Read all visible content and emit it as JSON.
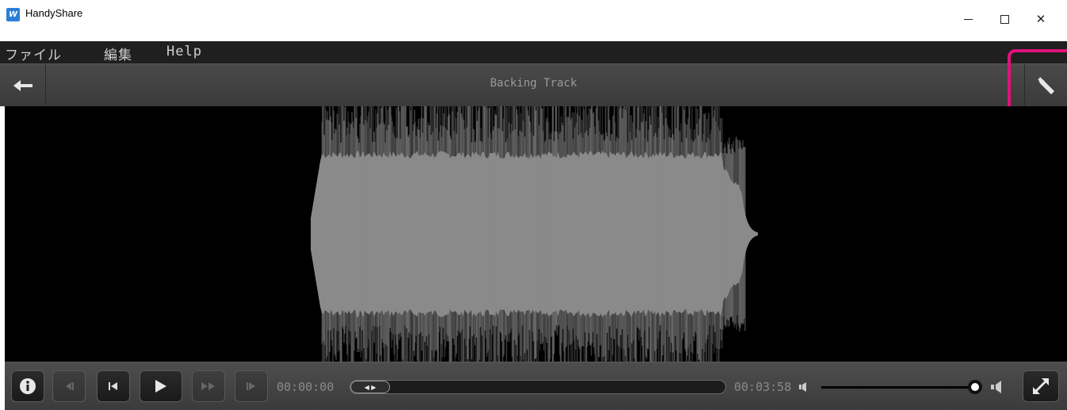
{
  "window": {
    "app_icon": "app-logo-icon",
    "app_icon_text": "W",
    "title": "HandyShare",
    "minimize_icon": "minimize-icon",
    "maximize_icon": "maximize-icon",
    "close_icon": "close-icon",
    "close_glyph": "✕"
  },
  "menu": {
    "items": [
      {
        "label": "ファイル"
      },
      {
        "label": "編集"
      },
      {
        "label": "Help"
      }
    ]
  },
  "header": {
    "title": "Backing Track",
    "back_icon": "arrow-left-icon",
    "back_glyph": "🡐",
    "settings_icon": "wrench-icon",
    "highlight_color": "#e0127a"
  },
  "waveform": {
    "color": "#8a8a8a",
    "background": "#000000"
  },
  "transport": {
    "info_icon": "info-icon",
    "rewind_icon": "step-back-icon",
    "prev_icon": "skip-previous-icon",
    "play_icon": "play-icon",
    "ffwd_icon": "fast-forward-icon",
    "next_icon": "skip-next-icon",
    "current_time": "00:00:00",
    "total_time": "00:03:58",
    "seek_thumb_glyph": "◀ ▶",
    "seek_position": 0.0,
    "volume_level": 1.0,
    "volume_low_icon": "volume-low-icon",
    "volume_high_icon": "volume-high-icon",
    "fullscreen_icon": "expand-icon"
  }
}
